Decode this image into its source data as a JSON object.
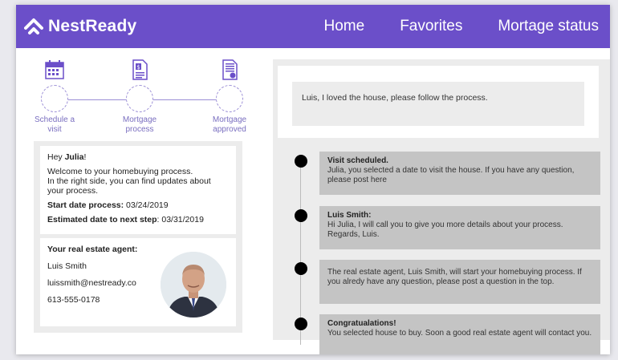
{
  "brand": {
    "name": "NestReady"
  },
  "nav": {
    "items": [
      "Home",
      "Favorites",
      "Mortage status"
    ]
  },
  "steps": [
    {
      "label_line1": "Schedule a",
      "label_line2": "visit",
      "icon": "calendar-icon"
    },
    {
      "label_line1": "Mortgage",
      "label_line2": "process",
      "icon": "document-dollar-icon"
    },
    {
      "label_line1": "Mortgage",
      "label_line2": "approved",
      "icon": "document-approved-icon"
    }
  ],
  "greeting": {
    "hey": "Hey ",
    "name": "Julia",
    "exclaim": "!",
    "line1": "Welcome to your homebuying process.",
    "line2": "In the right side, you can find updates about your process.",
    "start_label": "Start date process:",
    "start_value": " 03/24/2019",
    "next_label": "Estimated date to next step",
    "next_value": ": 03/31/2019"
  },
  "agent": {
    "title": "Your real estate agent:",
    "name": "Luis Smith",
    "email": "luissmith@nestready.co",
    "phone": "613-555-0178"
  },
  "message": {
    "text": "Luis, I loved the house, please follow the process."
  },
  "timeline": [
    {
      "title": "Visit scheduled.",
      "body": "Julia, you selected a date to visit the house. If you have any question, please post here"
    },
    {
      "title": "Luis Smith:",
      "body": "Hi Julia, I will call you to give you more details about your process. Regards,  Luis."
    },
    {
      "title": "",
      "body": "The real estate agent, Luis Smith, will start your homebuying process. If you alredy have any question, please post a question in the top."
    },
    {
      "title": "Congratualations!",
      "body": "You selected house to buy. Soon a good real estate agent will contact you."
    }
  ],
  "colors": {
    "brand": "#6b4fc9",
    "step_accent": "#7a6fc0",
    "panel": "#ececec",
    "timeline_card": "#c4c4c4"
  }
}
